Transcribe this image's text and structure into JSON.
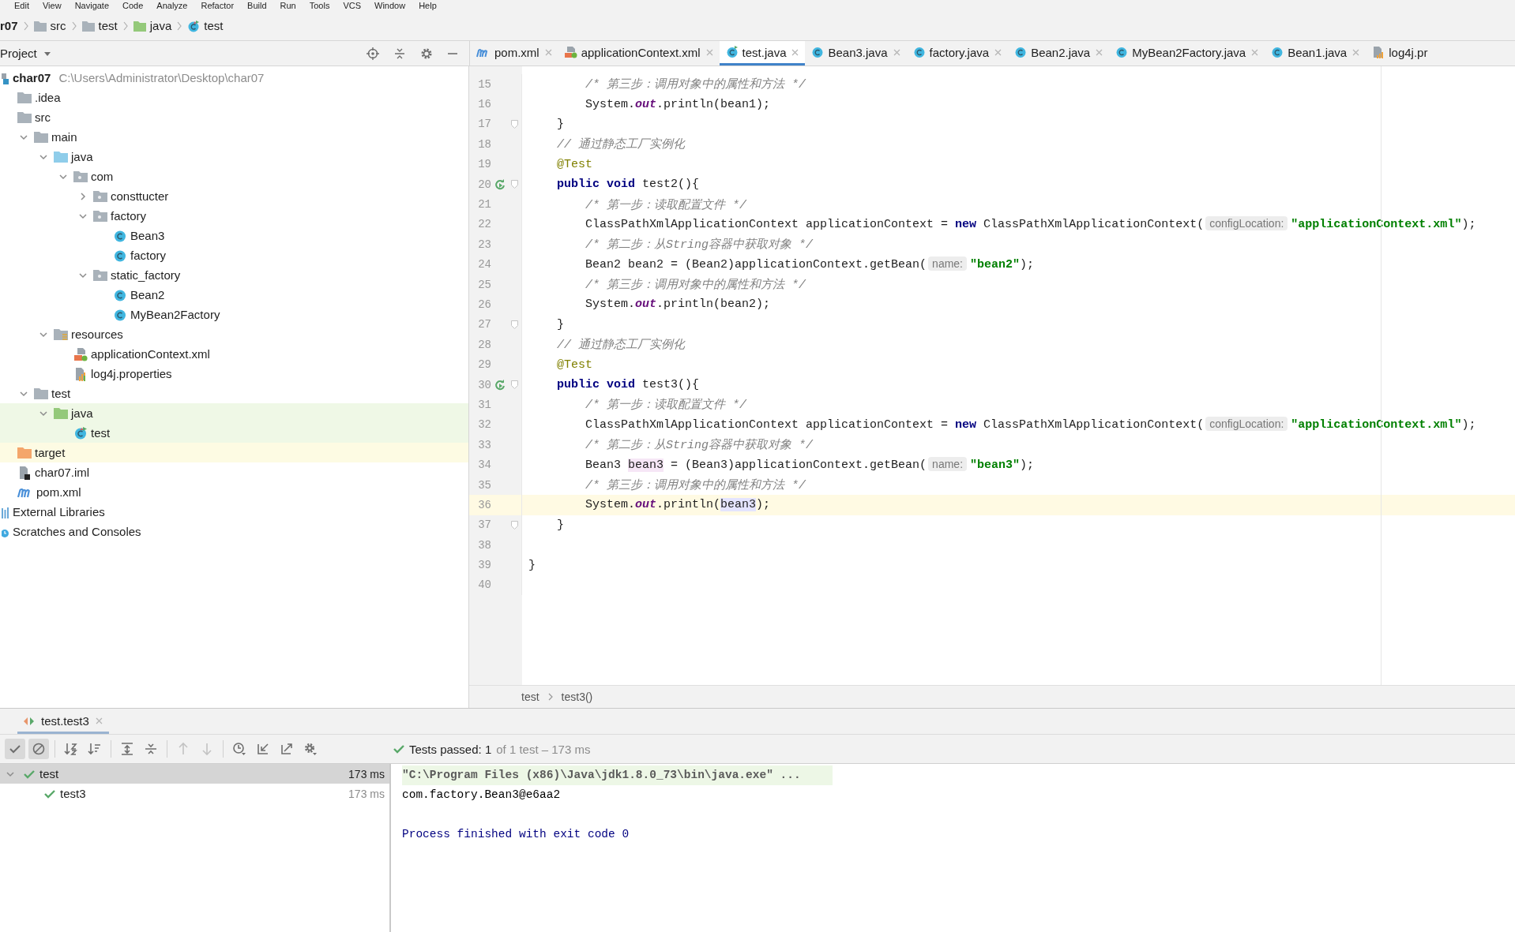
{
  "menu": [
    "Edit",
    "View",
    "Navigate",
    "Code",
    "Analyze",
    "Refactor",
    "Build",
    "Run",
    "Tools",
    "VCS",
    "Window",
    "Help"
  ],
  "nav_bar": [
    {
      "label": "r07",
      "kind": "module"
    },
    {
      "label": "src",
      "kind": "folder"
    },
    {
      "label": "test",
      "kind": "folder"
    },
    {
      "label": "java",
      "kind": "test-root"
    },
    {
      "label": "test",
      "kind": "test-class"
    }
  ],
  "project_panel": {
    "title": "Project",
    "tree": [
      {
        "label": "char07",
        "path": "C:\\Users\\Administrator\\Desktop\\char07",
        "kind": "module",
        "children": [
          {
            "label": ".idea",
            "kind": "folder"
          },
          {
            "label": "src",
            "kind": "folder",
            "children": [
              {
                "label": "main",
                "kind": "folder",
                "expanded": true,
                "children": [
                  {
                    "label": "java",
                    "kind": "source-root",
                    "expanded": true,
                    "children": [
                      {
                        "label": "com",
                        "kind": "package",
                        "expanded": true,
                        "children": [
                          {
                            "label": "consttucter",
                            "kind": "package",
                            "expanded": false
                          },
                          {
                            "label": "factory",
                            "kind": "package",
                            "expanded": true,
                            "children": [
                              {
                                "label": "Bean3",
                                "kind": "class"
                              },
                              {
                                "label": "factory",
                                "kind": "class"
                              }
                            ]
                          },
                          {
                            "label": "static_factory",
                            "kind": "package",
                            "expanded": true,
                            "children": [
                              {
                                "label": "Bean2",
                                "kind": "class"
                              },
                              {
                                "label": "MyBean2Factory",
                                "kind": "class"
                              }
                            ]
                          }
                        ]
                      }
                    ]
                  },
                  {
                    "label": "resources",
                    "kind": "resources",
                    "expanded": true,
                    "children": [
                      {
                        "label": "applicationContext.xml",
                        "kind": "xml"
                      },
                      {
                        "label": "log4j.properties",
                        "kind": "props"
                      }
                    ]
                  }
                ]
              },
              {
                "label": "test",
                "kind": "folder",
                "expanded": true,
                "children": [
                  {
                    "label": "java",
                    "kind": "test-root",
                    "expanded": true,
                    "children": [
                      {
                        "label": "test",
                        "kind": "test-class"
                      }
                    ]
                  }
                ]
              }
            ]
          },
          {
            "label": "target",
            "kind": "excluded-folder"
          },
          {
            "label": "char07.iml",
            "kind": "iml"
          },
          {
            "label": "pom.xml",
            "kind": "maven"
          }
        ]
      },
      {
        "label": "External Libraries",
        "kind": "libraries"
      },
      {
        "label": "Scratches and Consoles",
        "kind": "scratches"
      }
    ]
  },
  "editor_tabs": [
    {
      "label": "pom.xml",
      "kind": "maven",
      "selected": false
    },
    {
      "label": "applicationContext.xml",
      "kind": "xml",
      "selected": false
    },
    {
      "label": "test.java",
      "kind": "test-class",
      "selected": true
    },
    {
      "label": "Bean3.java",
      "kind": "class",
      "selected": false
    },
    {
      "label": "factory.java",
      "kind": "class",
      "selected": false
    },
    {
      "label": "Bean2.java",
      "kind": "class",
      "selected": false
    },
    {
      "label": "MyBean2Factory.java",
      "kind": "class",
      "selected": false
    },
    {
      "label": "Bean1.java",
      "kind": "class",
      "selected": false
    },
    {
      "label": "log4j.pr",
      "kind": "props",
      "selected": false
    }
  ],
  "code_lines": [
    {
      "number": "15",
      "current": false,
      "run_icon": false,
      "fold": false,
      "tokens": [
        {
          "text": "        /* 第三步：调用对象中的属性和方法 */",
          "kind": "comment"
        }
      ]
    },
    {
      "number": "16",
      "current": false,
      "run_icon": false,
      "fold": false,
      "tokens": [
        {
          "text": "        System.",
          "kind": "plain"
        },
        {
          "text": "out",
          "kind": "field"
        },
        {
          "text": ".println(bean1);",
          "kind": "plain"
        }
      ]
    },
    {
      "number": "17",
      "current": false,
      "run_icon": false,
      "fold": true,
      "tokens": [
        {
          "text": "    }",
          "kind": "plain"
        }
      ]
    },
    {
      "number": "18",
      "current": false,
      "run_icon": false,
      "fold": false,
      "tokens": [
        {
          "text": "    // 通过静态工厂实例化",
          "kind": "comment"
        }
      ]
    },
    {
      "number": "19",
      "current": false,
      "run_icon": false,
      "fold": false,
      "tokens": [
        {
          "text": "    @Test",
          "kind": "anno"
        }
      ]
    },
    {
      "number": "20",
      "current": false,
      "run_icon": true,
      "fold": true,
      "tokens": [
        {
          "text": "    public",
          "kind": "kw"
        },
        {
          "text": " void",
          "kind": "kw"
        },
        {
          "text": " test2(){",
          "kind": "plain"
        }
      ]
    },
    {
      "number": "21",
      "current": false,
      "run_icon": false,
      "fold": false,
      "tokens": [
        {
          "text": "        /* 第一步：读取配置文件 */",
          "kind": "comment"
        }
      ]
    },
    {
      "number": "22",
      "current": false,
      "run_icon": false,
      "fold": false,
      "tokens": [
        {
          "text": "        ClassPathXmlApplicationContext applicationContext = ",
          "kind": "plain"
        },
        {
          "text": "new",
          "kind": "kw"
        },
        {
          "text": " ClassPathXmlApplicationContext(",
          "kind": "plain"
        },
        {
          "text": "configLocation:",
          "kind": "hint"
        },
        {
          "text": "\"applicationContext.xml\"",
          "kind": "str"
        },
        {
          "text": ");",
          "kind": "plain"
        }
      ]
    },
    {
      "number": "23",
      "current": false,
      "run_icon": false,
      "fold": false,
      "tokens": [
        {
          "text": "        /* 第二步：从String容器中获取对象 */",
          "kind": "comment"
        }
      ]
    },
    {
      "number": "24",
      "current": false,
      "run_icon": false,
      "fold": false,
      "tokens": [
        {
          "text": "        Bean2 bean2 = (Bean2)applicationContext.getBean(",
          "kind": "plain"
        },
        {
          "text": "name:",
          "kind": "hint"
        },
        {
          "text": "\"bean2\"",
          "kind": "str"
        },
        {
          "text": ");",
          "kind": "plain"
        }
      ]
    },
    {
      "number": "25",
      "current": false,
      "run_icon": false,
      "fold": false,
      "tokens": [
        {
          "text": "        /* 第三步：调用对象中的属性和方法 */",
          "kind": "comment"
        }
      ]
    },
    {
      "number": "26",
      "current": false,
      "run_icon": false,
      "fold": false,
      "tokens": [
        {
          "text": "        System.",
          "kind": "plain"
        },
        {
          "text": "out",
          "kind": "field"
        },
        {
          "text": ".println(bean2);",
          "kind": "plain"
        }
      ]
    },
    {
      "number": "27",
      "current": false,
      "run_icon": false,
      "fold": true,
      "tokens": [
        {
          "text": "    }",
          "kind": "plain"
        }
      ]
    },
    {
      "number": "28",
      "current": false,
      "run_icon": false,
      "fold": false,
      "tokens": [
        {
          "text": "    // 通过静态工厂实例化",
          "kind": "comment"
        }
      ]
    },
    {
      "number": "29",
      "current": false,
      "run_icon": false,
      "fold": false,
      "tokens": [
        {
          "text": "    @Test",
          "kind": "anno"
        }
      ]
    },
    {
      "number": "30",
      "current": false,
      "run_icon": true,
      "fold": true,
      "tokens": [
        {
          "text": "    public",
          "kind": "kw"
        },
        {
          "text": " void",
          "kind": "kw"
        },
        {
          "text": " test3(){",
          "kind": "plain"
        }
      ]
    },
    {
      "number": "31",
      "current": false,
      "run_icon": false,
      "fold": false,
      "tokens": [
        {
          "text": "        /* 第一步：读取配置文件 */",
          "kind": "comment"
        }
      ]
    },
    {
      "number": "32",
      "current": false,
      "run_icon": false,
      "fold": false,
      "tokens": [
        {
          "text": "        ClassPathXmlApplicationContext applicationContext = ",
          "kind": "plain"
        },
        {
          "text": "new",
          "kind": "kw"
        },
        {
          "text": " ClassPathXmlApplicationContext(",
          "kind": "plain"
        },
        {
          "text": "configLocation:",
          "kind": "hint"
        },
        {
          "text": "\"applicationContext.xml\"",
          "kind": "str"
        },
        {
          "text": ");",
          "kind": "plain"
        }
      ]
    },
    {
      "number": "33",
      "current": false,
      "run_icon": false,
      "fold": false,
      "tokens": [
        {
          "text": "        /* 第二步：从String容器中获取对象 */",
          "kind": "comment"
        }
      ]
    },
    {
      "number": "34",
      "current": false,
      "run_icon": false,
      "fold": false,
      "tokens": [
        {
          "text": "        Bean3 ",
          "kind": "plain"
        },
        {
          "text": "bean3",
          "kind": "def"
        },
        {
          "text": " = (Bean3)applicationContext.getBean(",
          "kind": "plain"
        },
        {
          "text": "name:",
          "kind": "hint"
        },
        {
          "text": "\"bean3\"",
          "kind": "str"
        },
        {
          "text": ");",
          "kind": "plain"
        }
      ]
    },
    {
      "number": "35",
      "current": false,
      "run_icon": false,
      "fold": false,
      "tokens": [
        {
          "text": "        /* 第三步：调用对象中的属性和方法 */",
          "kind": "comment"
        }
      ]
    },
    {
      "number": "36",
      "current": true,
      "run_icon": false,
      "fold": false,
      "tokens": [
        {
          "text": "        System.",
          "kind": "plain"
        },
        {
          "text": "out",
          "kind": "field"
        },
        {
          "text": ".println(",
          "kind": "plain"
        },
        {
          "text": "bean3",
          "kind": "use"
        },
        {
          "text": ");",
          "kind": "plain"
        }
      ]
    },
    {
      "number": "37",
      "current": false,
      "run_icon": false,
      "fold": true,
      "tokens": [
        {
          "text": "    }",
          "kind": "plain"
        }
      ]
    },
    {
      "number": "38",
      "current": false,
      "run_icon": false,
      "fold": false
    },
    {
      "number": "39",
      "current": false,
      "run_icon": false,
      "fold": false,
      "tokens": [
        {
          "text": "}",
          "kind": "plain"
        }
      ]
    },
    {
      "number": "40",
      "current": false,
      "run_icon": false,
      "fold": false
    }
  ],
  "editor_breadcrumb": [
    "test",
    "test3()"
  ],
  "run_tab": {
    "label": "test.test3"
  },
  "run_toolbar": [
    {
      "kind": "check",
      "selected": true,
      "disabled": false
    },
    {
      "kind": "stop",
      "selected": true,
      "disabled": false
    },
    {
      "kind": "sort-alpha",
      "selected": false,
      "disabled": false
    },
    {
      "kind": "sort-duration",
      "selected": false,
      "disabled": false
    },
    {
      "kind": "expand-all",
      "selected": false,
      "disabled": false
    },
    {
      "kind": "collapse-all",
      "selected": false,
      "disabled": false
    },
    {
      "kind": "up",
      "selected": false,
      "disabled": true
    },
    {
      "kind": "down",
      "selected": false,
      "disabled": true
    },
    {
      "kind": "history",
      "selected": false,
      "disabled": false
    },
    {
      "kind": "import",
      "selected": false,
      "disabled": false
    },
    {
      "kind": "export",
      "selected": false,
      "disabled": false
    },
    {
      "kind": "settings",
      "selected": false,
      "disabled": false
    }
  ],
  "test_status": {
    "summary": "Tests passed: 1",
    "detail": "of 1 test – 173 ms"
  },
  "test_tree": [
    {
      "name": "test",
      "time": "173 ms",
      "kind": "passed",
      "selected": true,
      "expanded": true,
      "children": [
        {
          "name": "test3",
          "time": "173 ms",
          "kind": "passed",
          "selected": false
        }
      ]
    }
  ],
  "console": [
    {
      "text": "\"C:\\Program Files (x86)\\Java\\jdk1.8.0_73\\bin\\java.exe\" ...",
      "kind": "command"
    },
    {
      "text": "com.factory.Bean3@e6aa2",
      "kind": "output"
    },
    {
      "text": "Process finished with exit code 0",
      "kind": "system"
    }
  ]
}
